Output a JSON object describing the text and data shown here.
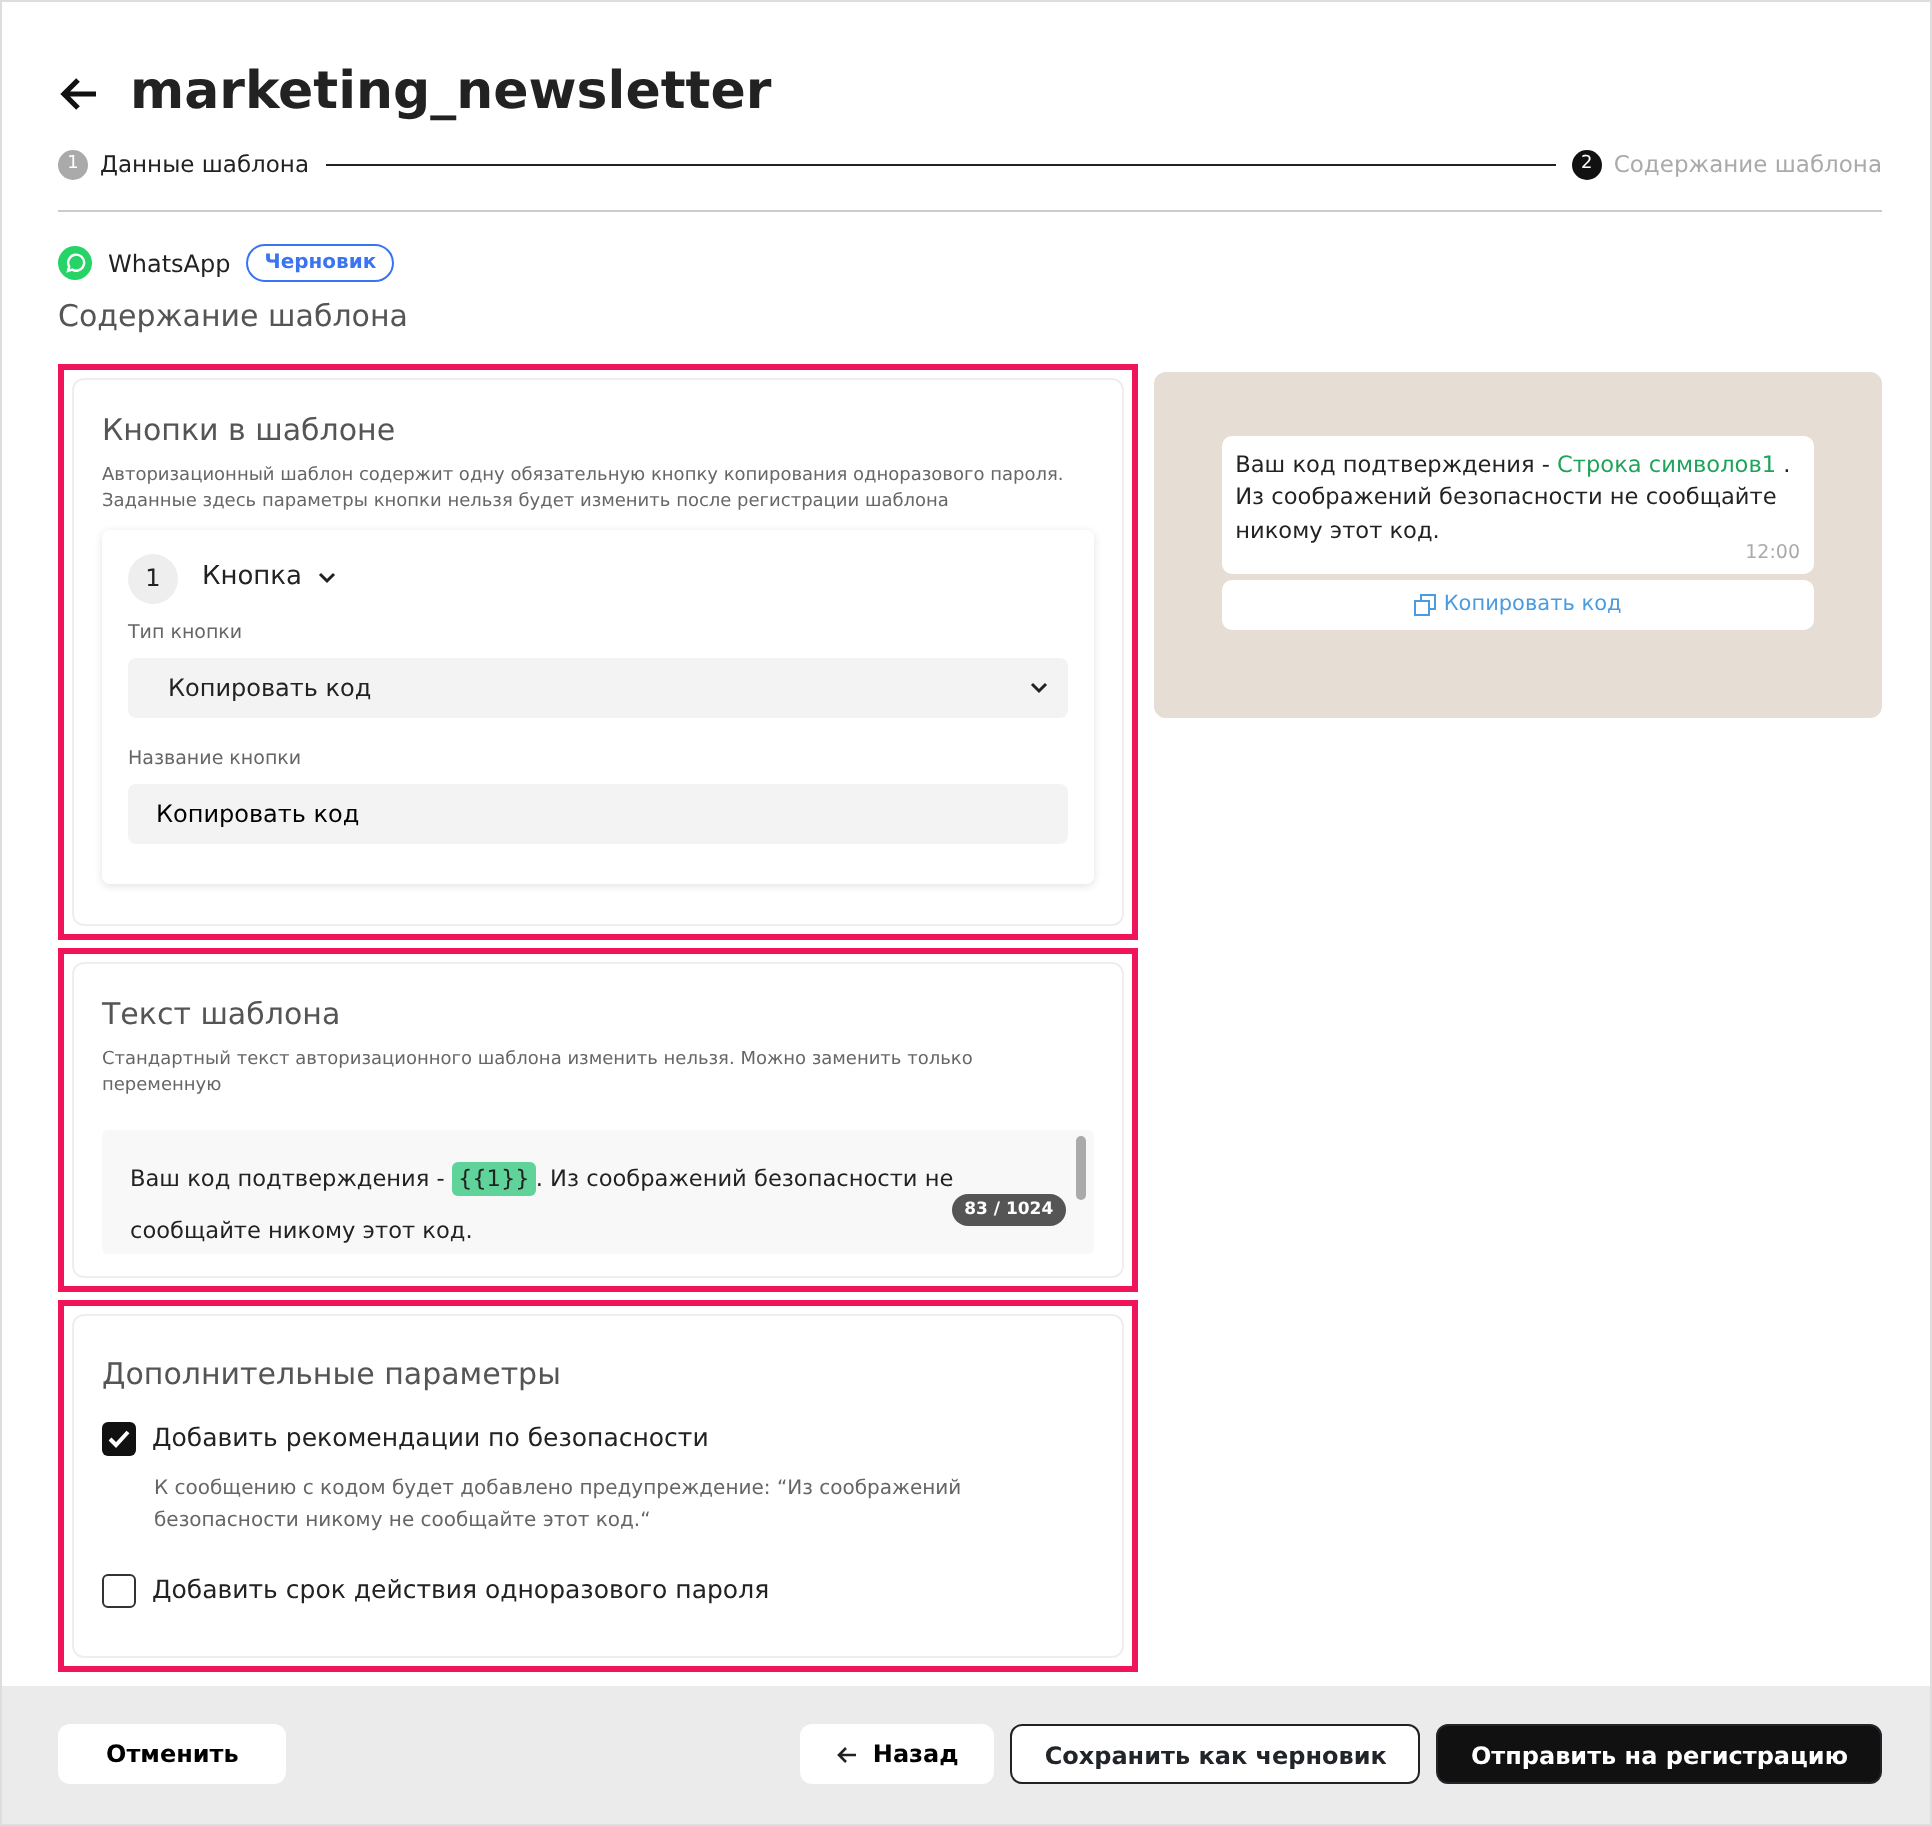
{
  "header": {
    "title": "marketing_newsletter"
  },
  "steps": [
    {
      "number": "1",
      "label": "Данные шаблона",
      "selected": false
    },
    {
      "number": "2",
      "label": "Содержание шаблона",
      "selected": true
    }
  ],
  "channel": {
    "name": "WhatsApp",
    "status": "Черновик"
  },
  "section_title": "Содержание шаблона",
  "buttons_section": {
    "title": "Кнопки в шаблоне",
    "description": "Авторизационный шаблон содержит одну обязательную кнопку копирования одноразового пароля. Заданные здесь параметры кнопки нельзя будет изменить после регистрации шаблона",
    "button": {
      "number": "1",
      "title": "Кнопка",
      "expanded": true,
      "type_label": "Тип кнопки",
      "type_value": "Копировать код",
      "name_label": "Название кнопки",
      "name_value": "Копировать код"
    }
  },
  "text_section": {
    "title": "Текст шаблона",
    "description": "Стандартный текст авторизационного шаблона изменить нельзя. Можно заменить только переменную",
    "body_start": "Ваш код подтверждения - ",
    "variable": "{{1}}",
    "body_end": ". Из соображений безопасности не сообщайте никому этот код.",
    "counter": "83 / 1024"
  },
  "options_section": {
    "title": "Дополнительные параметры",
    "options": [
      {
        "label": "Добавить рекомендации по безопасности",
        "checked": true,
        "hint": "К сообщению с кодом будет добавлено предупреждение: “Из соображений безопасности никому не сообщайте этот код.“"
      },
      {
        "label": "Добавить срок действия одноразового пароля",
        "checked": false
      }
    ]
  },
  "preview": {
    "message_start": "Ваш код подтверждения - ",
    "variable": "Строка символов1",
    "message_end": " . Из соображений безопасности не сообщайте никому этот код.",
    "time": "12:00",
    "button": "Копировать код"
  },
  "footer": {
    "cancel": "Отменить",
    "back": "Назад",
    "save": "Сохранить как черновик",
    "submit": "Отправить на регистрацию"
  }
}
